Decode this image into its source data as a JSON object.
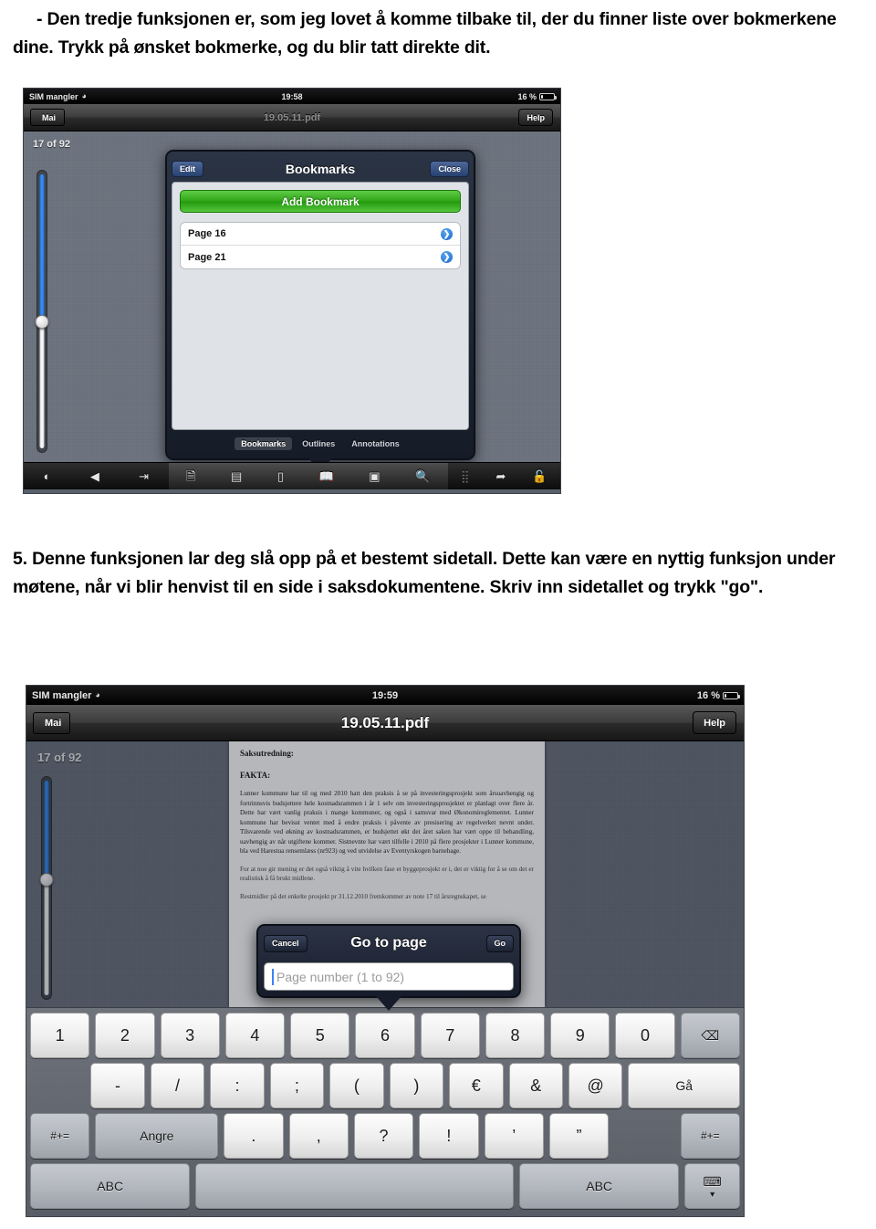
{
  "document": {
    "paragraph_1": "- Den tredje funksjonen er, som jeg lovet å komme tilbake til, der du finner liste over bokmerkene dine. Trykk på ønsket bokmerke, og du blir tatt direkte dit.",
    "paragraph_2": "5. Denne funksjonen lar deg slå opp på et bestemt sidetall. Dette kan være en nyttig funksjon under møtene, når vi blir henvist til en side i saksdokumentene. Skriv inn sidetallet og trykk \"go\"."
  },
  "screenshot_1": {
    "status_bar": {
      "carrier": "SIM mangler",
      "wifi_icon": "wifi-icon",
      "time": "19:58",
      "battery_percent": "16 %",
      "battery_icon": "battery-icon"
    },
    "nav_bar": {
      "back_label": "Mai",
      "title": "19.05.11.pdf",
      "help_label": "Help"
    },
    "reader": {
      "page_counter": "17 of 92"
    },
    "popover": {
      "edit_label": "Edit",
      "title": "Bookmarks",
      "close_label": "Close",
      "add_bookmark_label": "Add Bookmark",
      "add_bookmark_color": "#31a618",
      "bookmarks": [
        {
          "label": "Page 16",
          "chevron": "chevron-right-icon"
        },
        {
          "label": "Page 21",
          "chevron": "chevron-right-icon"
        }
      ],
      "tabs": [
        {
          "label": "Bookmarks",
          "active": true
        },
        {
          "label": "Outlines",
          "active": false
        },
        {
          "label": "Annotations",
          "active": false
        }
      ]
    },
    "toolbar": {
      "group_1": [
        {
          "name": "brightness-icon",
          "glyph": "◐"
        },
        {
          "name": "back-arrow-icon",
          "glyph": "◀"
        },
        {
          "name": "goto-page-icon",
          "glyph": "⇥"
        }
      ],
      "group_2": [
        {
          "name": "document-icon",
          "glyph": "🗎"
        },
        {
          "name": "page-layout-icon",
          "glyph": "▤"
        },
        {
          "name": "single-page-icon",
          "glyph": "▯"
        },
        {
          "name": "bookmarks-book-icon",
          "glyph": "📖"
        },
        {
          "name": "thumbnail-icon",
          "glyph": "▣"
        },
        {
          "name": "search-icon",
          "glyph": "🔍"
        }
      ],
      "group_3": [
        {
          "name": "grid-icon",
          "glyph": "⣿"
        },
        {
          "name": "share-icon",
          "glyph": "➦"
        },
        {
          "name": "lock-icon",
          "glyph": "🔓"
        }
      ]
    }
  },
  "screenshot_2": {
    "status_bar": {
      "carrier": "SIM mangler",
      "wifi_icon": "wifi-icon",
      "time": "19:59",
      "battery_percent": "16 %",
      "battery_icon": "battery-icon"
    },
    "nav_bar": {
      "back_label": "Mai",
      "title": "19.05.11.pdf",
      "help_label": "Help"
    },
    "reader": {
      "page_counter": "17 of 92"
    },
    "pdf_content": {
      "heading": "Saksutredning:",
      "subheading": "FAKTA:",
      "body": "Lunner kommune har til og med 2010 hatt den praksis å se på investeringsprosjekt som årsuavhengig og fortrinnsvis budsjettere hele kostnadsrammen i år 1 selv om investeringsprosjektet er planlagt over flere år. Dette har vært vanlig praksis i mange kommuner, og også i samsvar med Økonomireglementet. Lunner kommune har bevisst ventet med å endre praksis i påvente av presisering av regelverket nevnt under. Tilsvarende ved økning av kostnadsrammen, er budsjettet økt det året saken har vært oppe til behandling, uavhengig av når utgiftene kommer. Sistnevnte har vært tilfelle i 2010 på flere prosjekter i Lunner kommune, bla ved Harestua rensemlæss (nr923) og ved utvidelse av Eventyrskogen barnehage.",
      "body_2": "For at noe gir mening er det også viktig å vite hvilken fase et byggeprosjekt er i, det er viktig for å se om det er realistisk å få brukt midlene.",
      "body_3": "Restmidler på det enkelte prosjekt pr 31.12.2010 fremkommer av note 17 til årsregnskapet, se"
    },
    "modal": {
      "cancel_label": "Cancel",
      "title": "Go to page",
      "go_label": "Go",
      "input_value": "",
      "input_placeholder": "Page number (1 to 92)"
    },
    "keyboard": {
      "row_1": [
        "1",
        "2",
        "3",
        "4",
        "5",
        "6",
        "7",
        "8",
        "9",
        "0"
      ],
      "backspace_icon": "backspace-icon",
      "backspace_glyph": "⌫",
      "row_2": [
        "-",
        "/",
        ":",
        ";",
        "(",
        ")",
        "€",
        "&",
        "@"
      ],
      "row_2_action": "Gå",
      "row_3_symbol_left": "#+=",
      "row_3_undo": "Angre",
      "row_3": [
        ".",
        ",",
        "?",
        "!",
        "’",
        "”"
      ],
      "row_3_symbol_right": "#+=",
      "row_4_abc_left": "ABC",
      "row_4_space": "",
      "row_4_abc_right": "ABC",
      "row_4_hide_icon": "hide-keyboard-icon",
      "row_4_hide_glyph": "⌨"
    }
  }
}
